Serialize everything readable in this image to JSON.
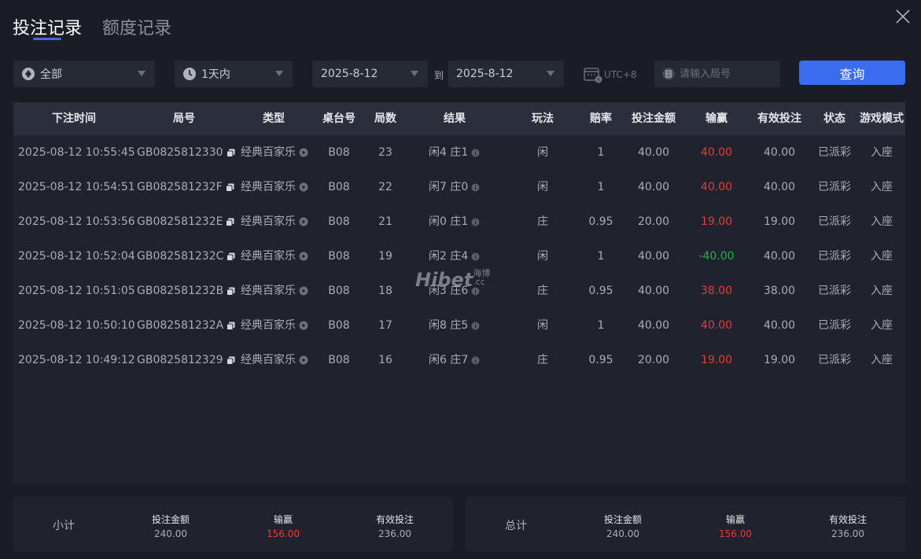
{
  "tabs": {
    "active": "投注记录",
    "inactive": "额度记录"
  },
  "filters": {
    "game": "全部",
    "period": "1天内",
    "date_from": "2025-8-12",
    "date_sep": "到",
    "date_to": "2025-8-12",
    "timezone": "UTC+8",
    "search_placeholder": "请输入局号",
    "query_label": "查询"
  },
  "table": {
    "headers": [
      "下注时间",
      "局号",
      "类型",
      "桌台号",
      "局数",
      "结果",
      "玩法",
      "赔率",
      "投注金额",
      "输赢",
      "有效投注",
      "状态",
      "游戏模式"
    ],
    "rows": [
      {
        "time": "2025-08-12 10:55:45",
        "round_id": "GB0825812330",
        "type": "经典百家乐",
        "table": "B08",
        "round": "23",
        "result": "闲4 庄1",
        "play": "闲",
        "odds": "1",
        "bet": "40.00",
        "winloss": "40.00",
        "outcome": "win",
        "valid": "40.00",
        "status": "已派彩",
        "mode": "入座"
      },
      {
        "time": "2025-08-12 10:54:51",
        "round_id": "GB082581232F",
        "type": "经典百家乐",
        "table": "B08",
        "round": "22",
        "result": "闲7 庄0",
        "play": "闲",
        "odds": "1",
        "bet": "40.00",
        "winloss": "40.00",
        "outcome": "win",
        "valid": "40.00",
        "status": "已派彩",
        "mode": "入座"
      },
      {
        "time": "2025-08-12 10:53:56",
        "round_id": "GB082581232E",
        "type": "经典百家乐",
        "table": "B08",
        "round": "21",
        "result": "闲0 庄1",
        "play": "庄",
        "odds": "0.95",
        "bet": "20.00",
        "winloss": "19.00",
        "outcome": "win",
        "valid": "19.00",
        "status": "已派彩",
        "mode": "入座"
      },
      {
        "time": "2025-08-12 10:52:04",
        "round_id": "GB082581232C",
        "type": "经典百家乐",
        "table": "B08",
        "round": "19",
        "result": "闲2 庄4",
        "play": "闲",
        "odds": "1",
        "bet": "40.00",
        "winloss": "-40.00",
        "outcome": "lose",
        "valid": "40.00",
        "status": "已派彩",
        "mode": "入座"
      },
      {
        "time": "2025-08-12 10:51:05",
        "round_id": "GB082581232B",
        "type": "经典百家乐",
        "table": "B08",
        "round": "18",
        "result": "闲3 庄6",
        "play": "庄",
        "odds": "0.95",
        "bet": "40.00",
        "winloss": "38.00",
        "outcome": "win",
        "valid": "38.00",
        "status": "已派彩",
        "mode": "入座"
      },
      {
        "time": "2025-08-12 10:50:10",
        "round_id": "GB082581232A",
        "type": "经典百家乐",
        "table": "B08",
        "round": "17",
        "result": "闲8 庄5",
        "play": "闲",
        "odds": "1",
        "bet": "40.00",
        "winloss": "40.00",
        "outcome": "win",
        "valid": "40.00",
        "status": "已派彩",
        "mode": "入座"
      },
      {
        "time": "2025-08-12 10:49:12",
        "round_id": "GB0825812329",
        "type": "经典百家乐",
        "table": "B08",
        "round": "16",
        "result": "闲6 庄7",
        "play": "庄",
        "odds": "0.95",
        "bet": "20.00",
        "winloss": "19.00",
        "outcome": "win",
        "valid": "19.00",
        "status": "已派彩",
        "mode": "入座"
      }
    ]
  },
  "watermark": {
    "main": "Hibet",
    "sub": "海博",
    "domain": ".cc"
  },
  "subtotal": {
    "title": "小计",
    "bet_label": "投注金额",
    "bet": "240.00",
    "winloss_label": "输赢",
    "winloss": "156.00",
    "valid_label": "有效投注",
    "valid": "236.00"
  },
  "total": {
    "title": "总计",
    "bet_label": "投注金额",
    "bet": "240.00",
    "winloss_label": "输赢",
    "winloss": "156.00",
    "valid_label": "有效投注",
    "valid": "236.00"
  },
  "colors": {
    "accent": "#3b6cf0",
    "win": "#e53b3b",
    "lose": "#1cb24a",
    "background": "#1b1d26"
  },
  "icons": [
    "close-icon",
    "chip-icon",
    "clock-icon",
    "caret-down-icon",
    "calendar-icon",
    "round-id-icon",
    "copy-icon",
    "play-circle-icon",
    "info-icon"
  ]
}
